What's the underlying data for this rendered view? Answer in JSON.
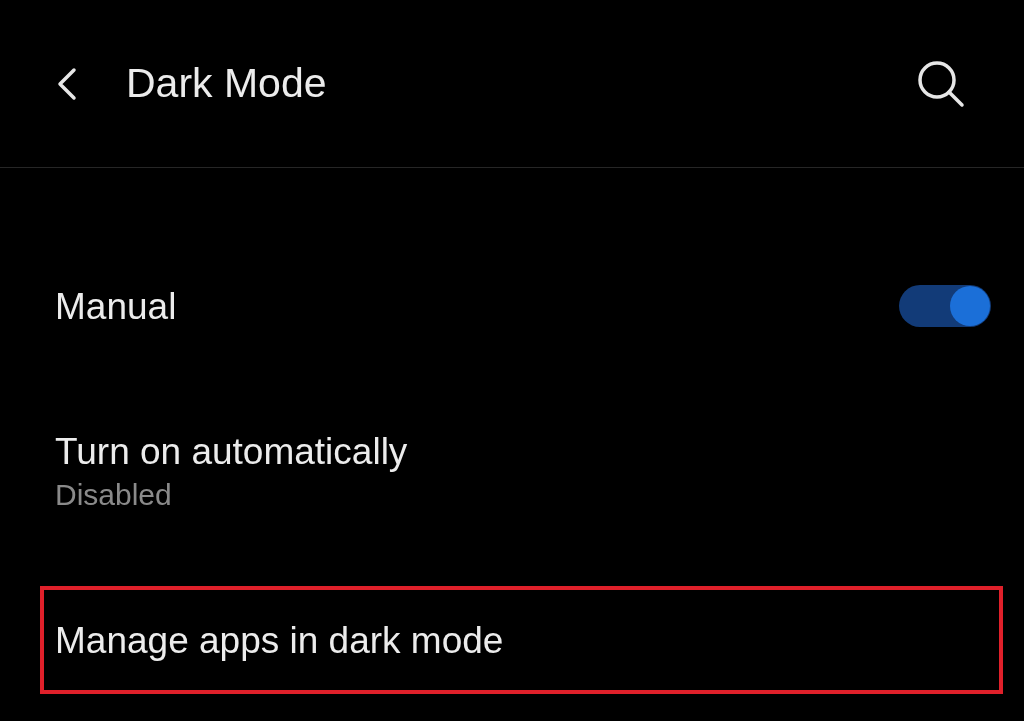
{
  "header": {
    "title": "Dark Mode"
  },
  "items": [
    {
      "kind": "toggle",
      "label": "Manual",
      "on": true,
      "highlighted": false
    },
    {
      "kind": "subtitle",
      "label": "Turn on automatically",
      "subtitle": "Disabled",
      "highlighted": false
    },
    {
      "kind": "plain",
      "label": "Manage apps in dark mode",
      "highlighted": true
    }
  ]
}
